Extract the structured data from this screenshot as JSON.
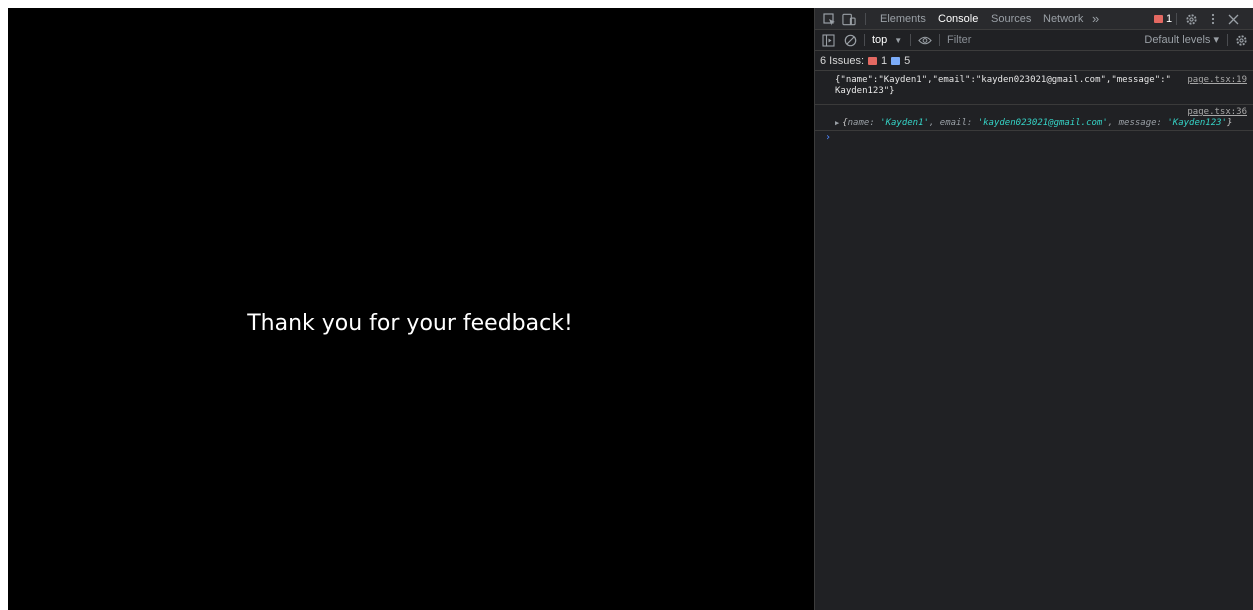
{
  "page": {
    "thank_you": "Thank you for your feedback!"
  },
  "devtools": {
    "tabs": {
      "elements": "Elements",
      "console": "Console",
      "sources": "Sources",
      "network": "Network",
      "more": "»"
    },
    "error_badge_count": "1",
    "toolbar": {
      "context": "top",
      "filter_placeholder": "Filter",
      "levels": "Default levels ▾"
    },
    "issues": {
      "label": "6 Issues:",
      "errors": "1",
      "info": "5"
    },
    "console": {
      "messages": [
        {
          "text_line1": "{\"name\":\"Kayden1\",\"email\":\"kayden023021@gmail.com\",\"message\":\"",
          "text_line2": "Kayden123\"}",
          "source": "page.tsx:19"
        },
        {
          "source": "page.tsx:36",
          "obj": {
            "open": "{",
            "name_key": "name: ",
            "name_val": "'Kayden1'",
            "email_key": ", email: ",
            "email_val": "'kayden023021@gmail.com'",
            "message_key": ", message: ",
            "message_val": "'Kayden123'",
            "close": "}"
          }
        }
      ],
      "prompt": "›"
    },
    "colors": {
      "error": "#e46962",
      "info": "#7cacf8",
      "string": "#35d4c7",
      "prompt": "#4d86ff"
    }
  }
}
